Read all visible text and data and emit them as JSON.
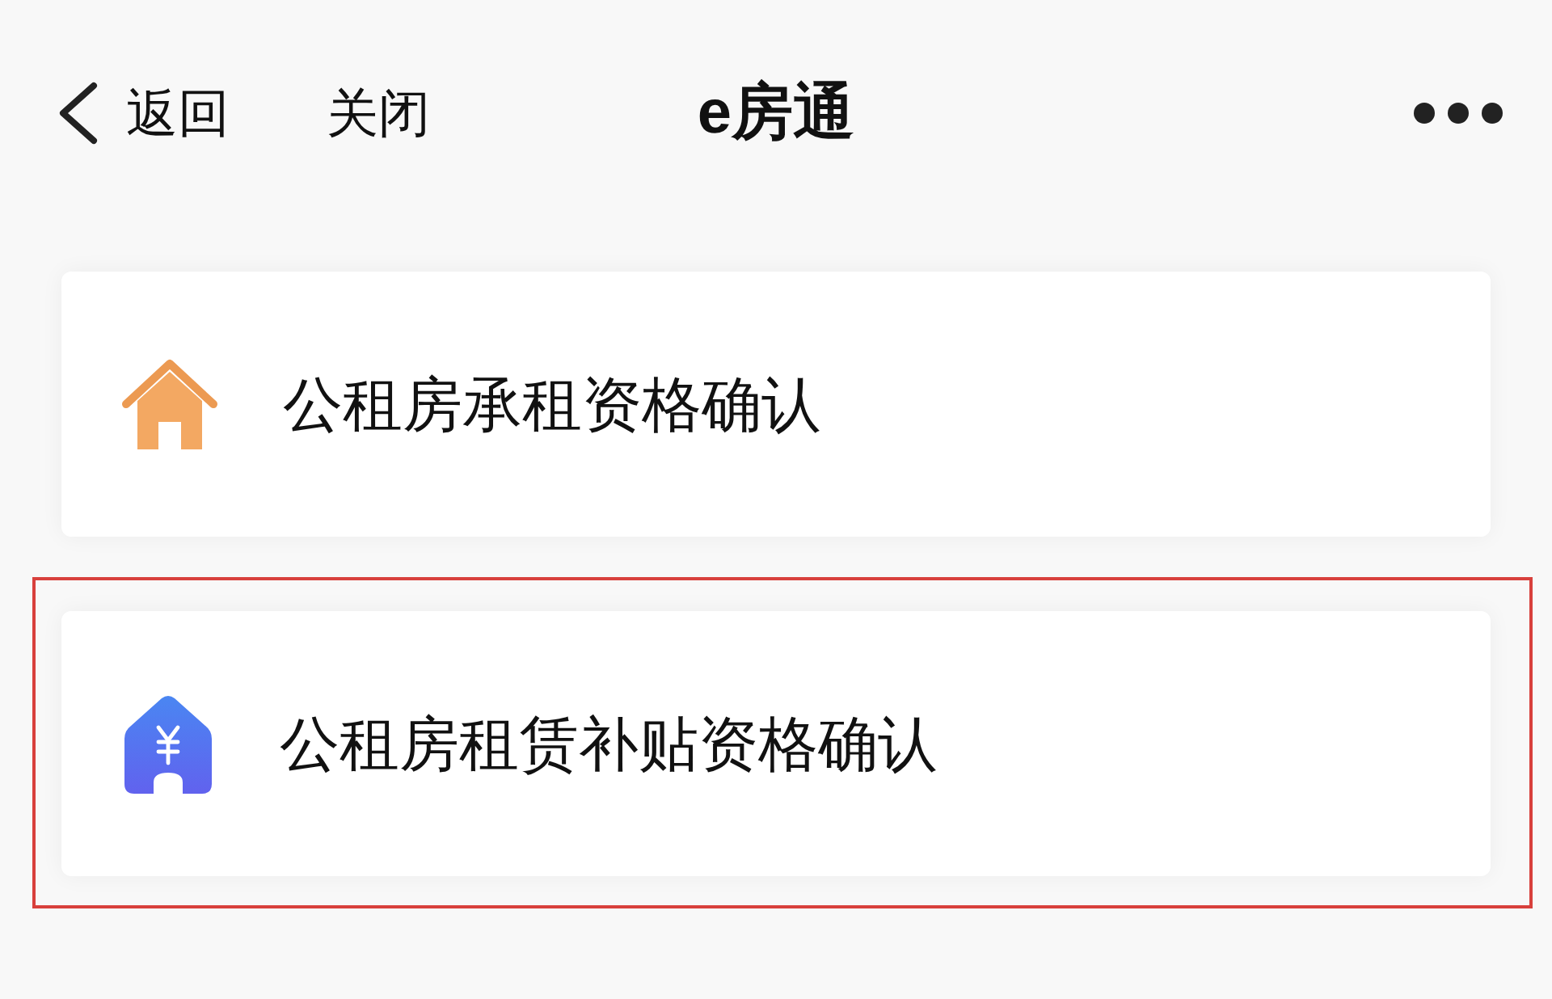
{
  "nav_bar": {
    "back_label": "返回",
    "close_label": "关闭",
    "title": "e房通"
  },
  "items": [
    {
      "kind": "lease",
      "label": "公租房承租资格确认",
      "highlighted": false
    },
    {
      "kind": "subsidy",
      "label": "公租房租赁补贴资格确认",
      "highlighted": true
    }
  ]
}
